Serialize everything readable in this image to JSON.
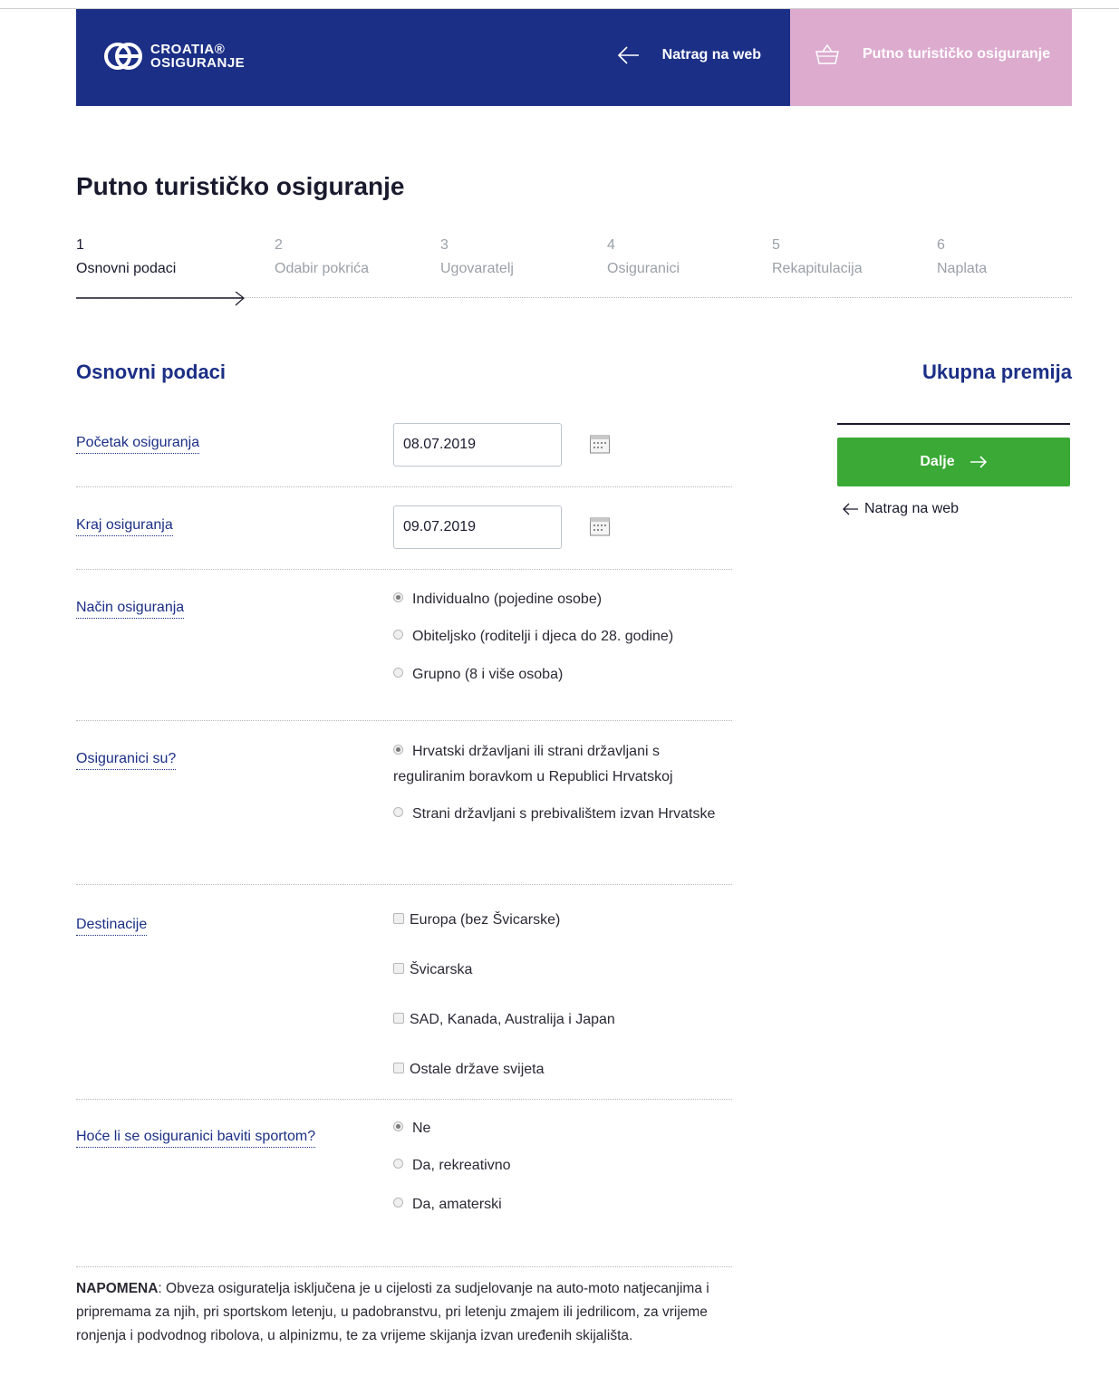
{
  "header": {
    "logo_line1": "CROATIA®",
    "logo_line2": "OSIGURANJE",
    "back_label": "Natrag na web",
    "cart_label": "Putno turističko osiguranje",
    "colors": {
      "primary": "#1b2f86",
      "cart_bg": "#dcabce",
      "accent_green": "#3aa935"
    }
  },
  "page_title": "Putno turističko osiguranje",
  "steps": [
    {
      "num": "1",
      "label": "Osnovni podaci",
      "active": true
    },
    {
      "num": "2",
      "label": "Odabir pokrića",
      "active": false
    },
    {
      "num": "3",
      "label": "Ugovaratelj",
      "active": false
    },
    {
      "num": "4",
      "label": "Osiguranici",
      "active": false
    },
    {
      "num": "5",
      "label": "Rekapitulacija",
      "active": false
    },
    {
      "num": "6",
      "label": "Naplata",
      "active": false
    }
  ],
  "section_title": "Osnovni podaci",
  "form": {
    "start": {
      "label": "Početak osiguranja",
      "value": "08.07.2019",
      "icon": "calendar-icon"
    },
    "end": {
      "label": "Kraj osiguranja",
      "value": "09.07.2019",
      "icon": "calendar-icon"
    },
    "mode": {
      "label": "Način osiguranja",
      "options": [
        "Individualno (pojedine osobe)",
        "Obiteljsko (roditelji i djeca do 28. godine)",
        "Grupno (8 i više osoba)"
      ],
      "selected": 0
    },
    "insured": {
      "label": "Osiguranici su?",
      "options": [
        "Hrvatski državljani ili strani državljani s reguliranim boravkom u Republici Hrvatskoj",
        "Strani državljani s prebivalištem izvan Hrvatske"
      ],
      "selected": 0
    },
    "destinations": {
      "label": "Destinacije",
      "options": [
        "Europa (bez Švicarske)",
        "Švicarska",
        "SAD, Kanada, Australija i Japan",
        "Ostale države svijeta"
      ]
    },
    "sport": {
      "label": "Hoće li se osiguranici baviti sportom?",
      "options": [
        "Ne",
        "Da, rekreativno",
        "Da, amaterski"
      ],
      "selected": 0
    }
  },
  "sidebar": {
    "premium_title": "Ukupna premija",
    "next_label": "Dalje",
    "back_label": "Natrag na web"
  },
  "note": {
    "prefix": "NAPOMENA",
    "text": ": Obveza osiguratelja isključena je u cijelosti za sudjelovanje na auto-moto natjecanjima i pripremama za njih, pri sportskom letenju, u padobranstvu, pri letenju zmajem ili jedrilicom, za vrijeme ronjenja i podvodnog ribolova, u alpinizmu, te za vrijeme skijanja izvan uređenih skijališta."
  }
}
